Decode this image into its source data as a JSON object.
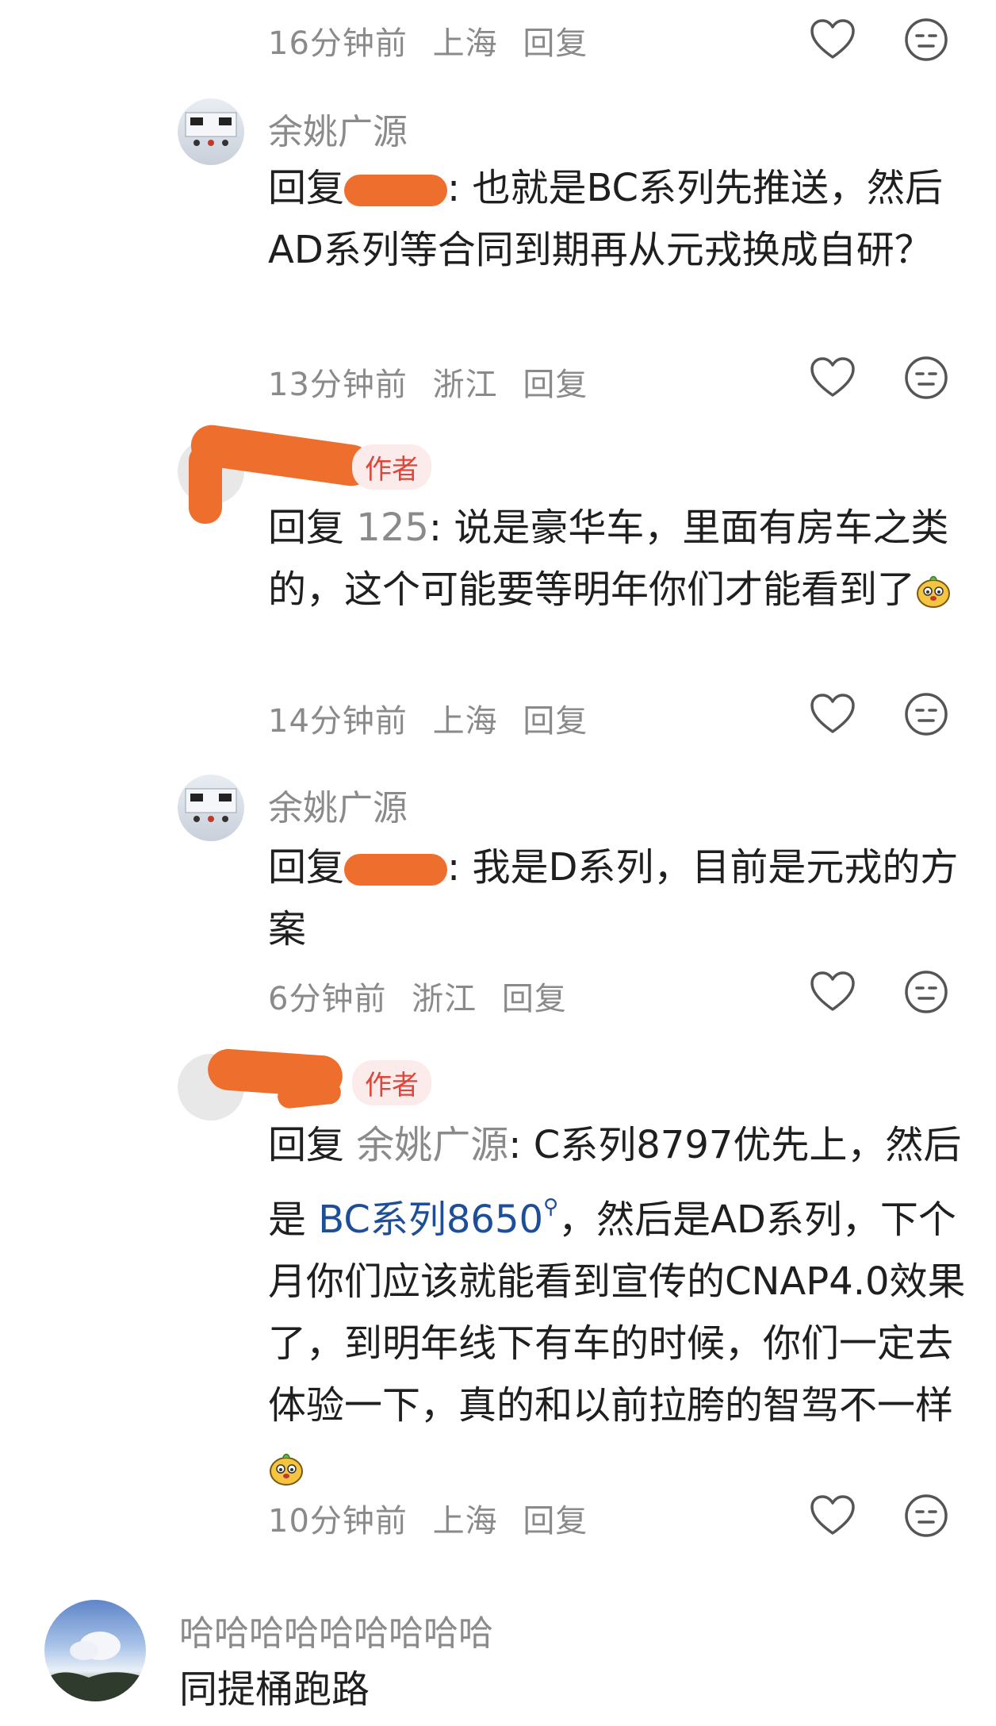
{
  "action_label": "回复",
  "colors": {
    "link": "#1f4e99",
    "author_badge": "#e0443a",
    "redaction": "#ee6f2d",
    "meta": "#8a8a8a"
  },
  "comments": [
    {
      "time": "16分钟前",
      "location": "上海"
    },
    {
      "user": "余姚广源",
      "reply_prefix": "回复",
      "text": ": 也就是BC系列先推送，然后AD系列等合同到期再从元戎换成自研？",
      "time": "13分钟前",
      "location": "浙江"
    },
    {
      "badge": "作者",
      "reply_prefix": "回复",
      "mention": "125",
      "text": ": 说是豪华车，里面有房车之类的，这个可能要等明年你们才能看到了",
      "time": "14分钟前",
      "location": "上海"
    },
    {
      "user": "余姚广源",
      "reply_prefix": "回复",
      "text": ": 我是D系列，目前是元戎的方案",
      "time": "6分钟前",
      "location": "浙江"
    },
    {
      "badge": "作者",
      "reply_prefix": "回复",
      "mention": "余姚广源",
      "text_a": ": C系列8797优先上，然后是",
      "link": "BC系列8650",
      "text_b": "，然后是AD系列，下个月你们应该就能看到宣传的CNAP4.0效果了，到明年线下有车的时候，你们一定去体验一下，真的和以前拉胯的智驾不一样",
      "time": "10分钟前",
      "location": "上海"
    },
    {
      "user": "哈哈哈哈哈哈哈哈哈",
      "text": "同提桶跑路"
    }
  ],
  "icons": [
    "heart-icon",
    "neutral-face-icon",
    "search-icon",
    "sticker-icon"
  ]
}
